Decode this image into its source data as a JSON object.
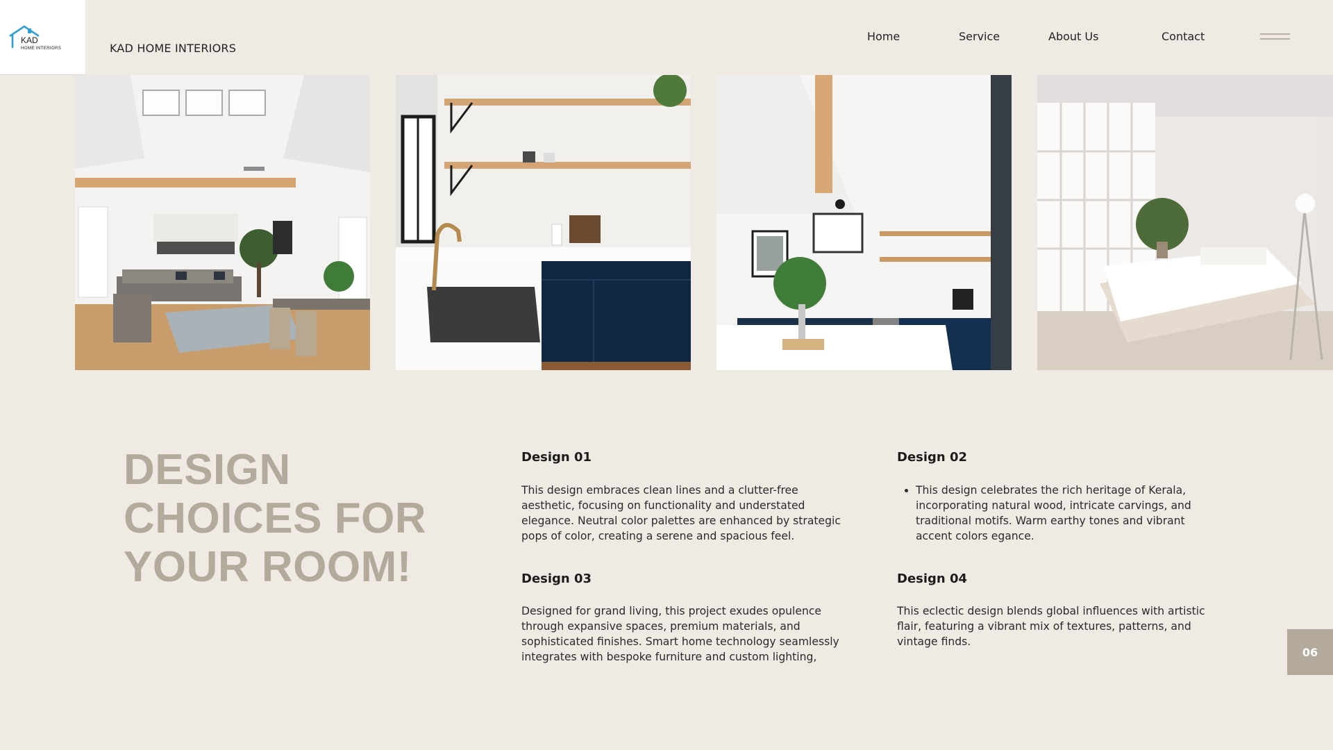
{
  "logo": {
    "line1": "KAD",
    "line2": "HOME INTERIORS"
  },
  "brand": "KAD HOME INTERIORS",
  "nav": [
    "Home",
    "Service",
    "About Us",
    "Contact"
  ],
  "headline": "DESIGN CHOICES FOR YOUR ROOM!",
  "designs": [
    {
      "title": "Design 01",
      "text": "This design embraces clean lines and a clutter-free aesthetic, focusing on functionality and understated elegance. Neutral color palettes are enhanced by strategic pops of color, creating a serene and spacious feel."
    },
    {
      "title": "Design 02",
      "text": "This design celebrates the rich heritage of Kerala, incorporating natural wood, intricate carvings, and traditional motifs. Warm earthy tones and vibrant accent colors egance."
    },
    {
      "title": "Design 03",
      "text": "Designed for grand living, this project exudes opulence through expansive spaces, premium materials, and sophisticated finishes. Smart home technology seamlessly integrates with bespoke furniture and custom lighting,"
    },
    {
      "title": "Design 04",
      "text": "This eclectic design blends global influences with artistic flair, featuring a vibrant mix of textures, patterns, and vintage finds."
    }
  ],
  "page_number": "06",
  "icons": [
    "house-logo-icon",
    "menu-icon"
  ],
  "colors": {
    "background": "#efebe4",
    "accent": "#b3aa9c",
    "navy_cabinet": "#0f2740",
    "wood": "#d8a874"
  }
}
